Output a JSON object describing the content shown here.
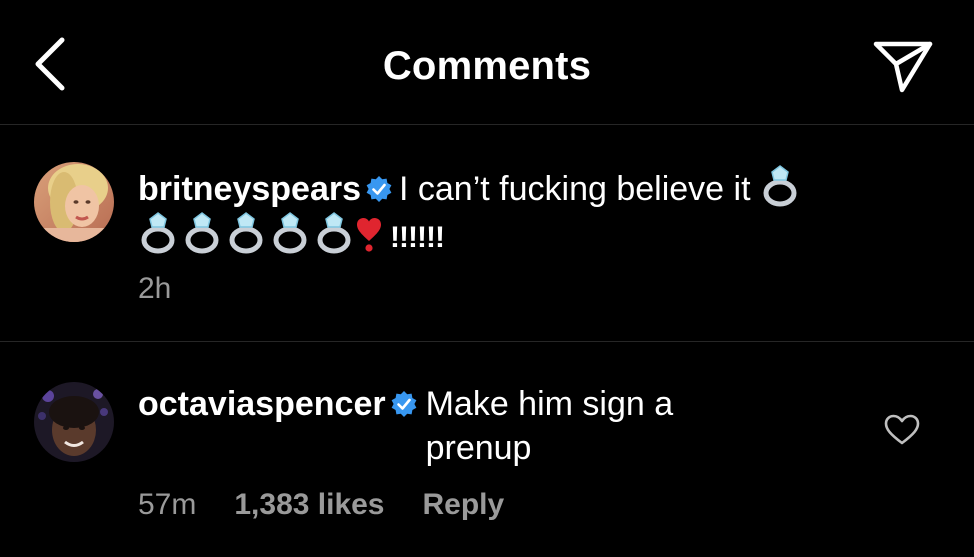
{
  "header": {
    "title": "Comments",
    "back_icon": "chevron-left-icon",
    "send_icon": "paper-plane-icon"
  },
  "colors": {
    "background": "#000000",
    "text": "#ffffff",
    "muted": "#9a9a9a",
    "verified_badge": "#3897f0",
    "divider": "#262626"
  },
  "comments": [
    {
      "username": "britneyspears",
      "verified": true,
      "text_start": "I can’t fucking believe it",
      "text_end": "!!!!!!",
      "emoji_sequence": [
        "ring-emoji",
        "ring-emoji",
        "ring-emoji",
        "ring-emoji",
        "ring-emoji",
        "ring-emoji",
        "heart-exclamation-emoji"
      ],
      "time": "2h"
    },
    {
      "username": "octaviaspencer",
      "verified": true,
      "text": "Make him sign a prenup",
      "time": "57m",
      "likes": "1,383 likes",
      "reply_label": "Reply",
      "like_icon": "heart-outline-icon"
    }
  ]
}
